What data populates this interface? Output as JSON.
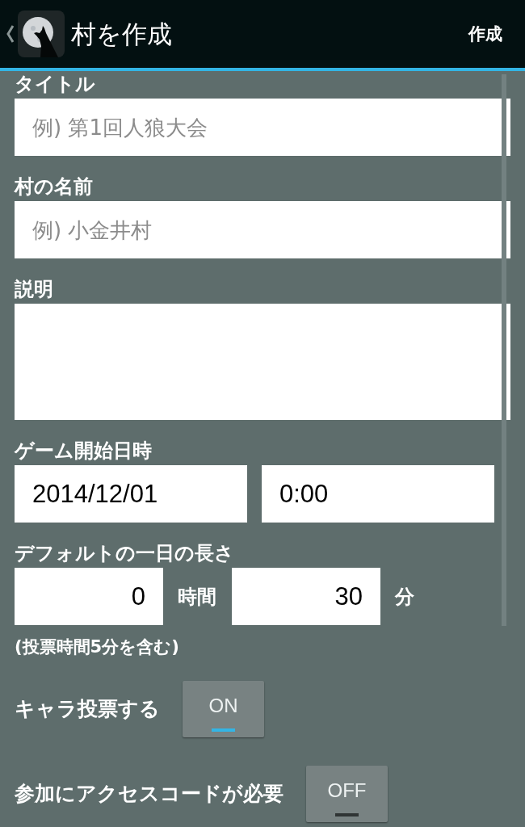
{
  "action_bar": {
    "title": "村を作成",
    "action": "作成"
  },
  "form": [
    {
      "kind": "text",
      "label": "タイトル",
      "placeholder": "例) 第1回人狼大会"
    },
    {
      "kind": "text",
      "label": "村の名前",
      "placeholder": "例) 小金井村"
    },
    {
      "kind": "textarea",
      "label": "説明"
    },
    {
      "kind": "datetime",
      "label": "ゲーム開始日時",
      "date": "2014/12/01",
      "time": "0:00"
    },
    {
      "kind": "duration",
      "label": "デフォルトの一日の長さ",
      "hours": "0",
      "hours_unit": "時間",
      "minutes": "30",
      "minutes_unit": "分",
      "note": "(投票時間5分を含む)"
    },
    {
      "kind": "toggle",
      "label": "キャラ投票する",
      "on": true,
      "text": "ON"
    },
    {
      "kind": "toggle",
      "label": "参加にアクセスコードが必要",
      "on": false,
      "text": "OFF"
    }
  ]
}
